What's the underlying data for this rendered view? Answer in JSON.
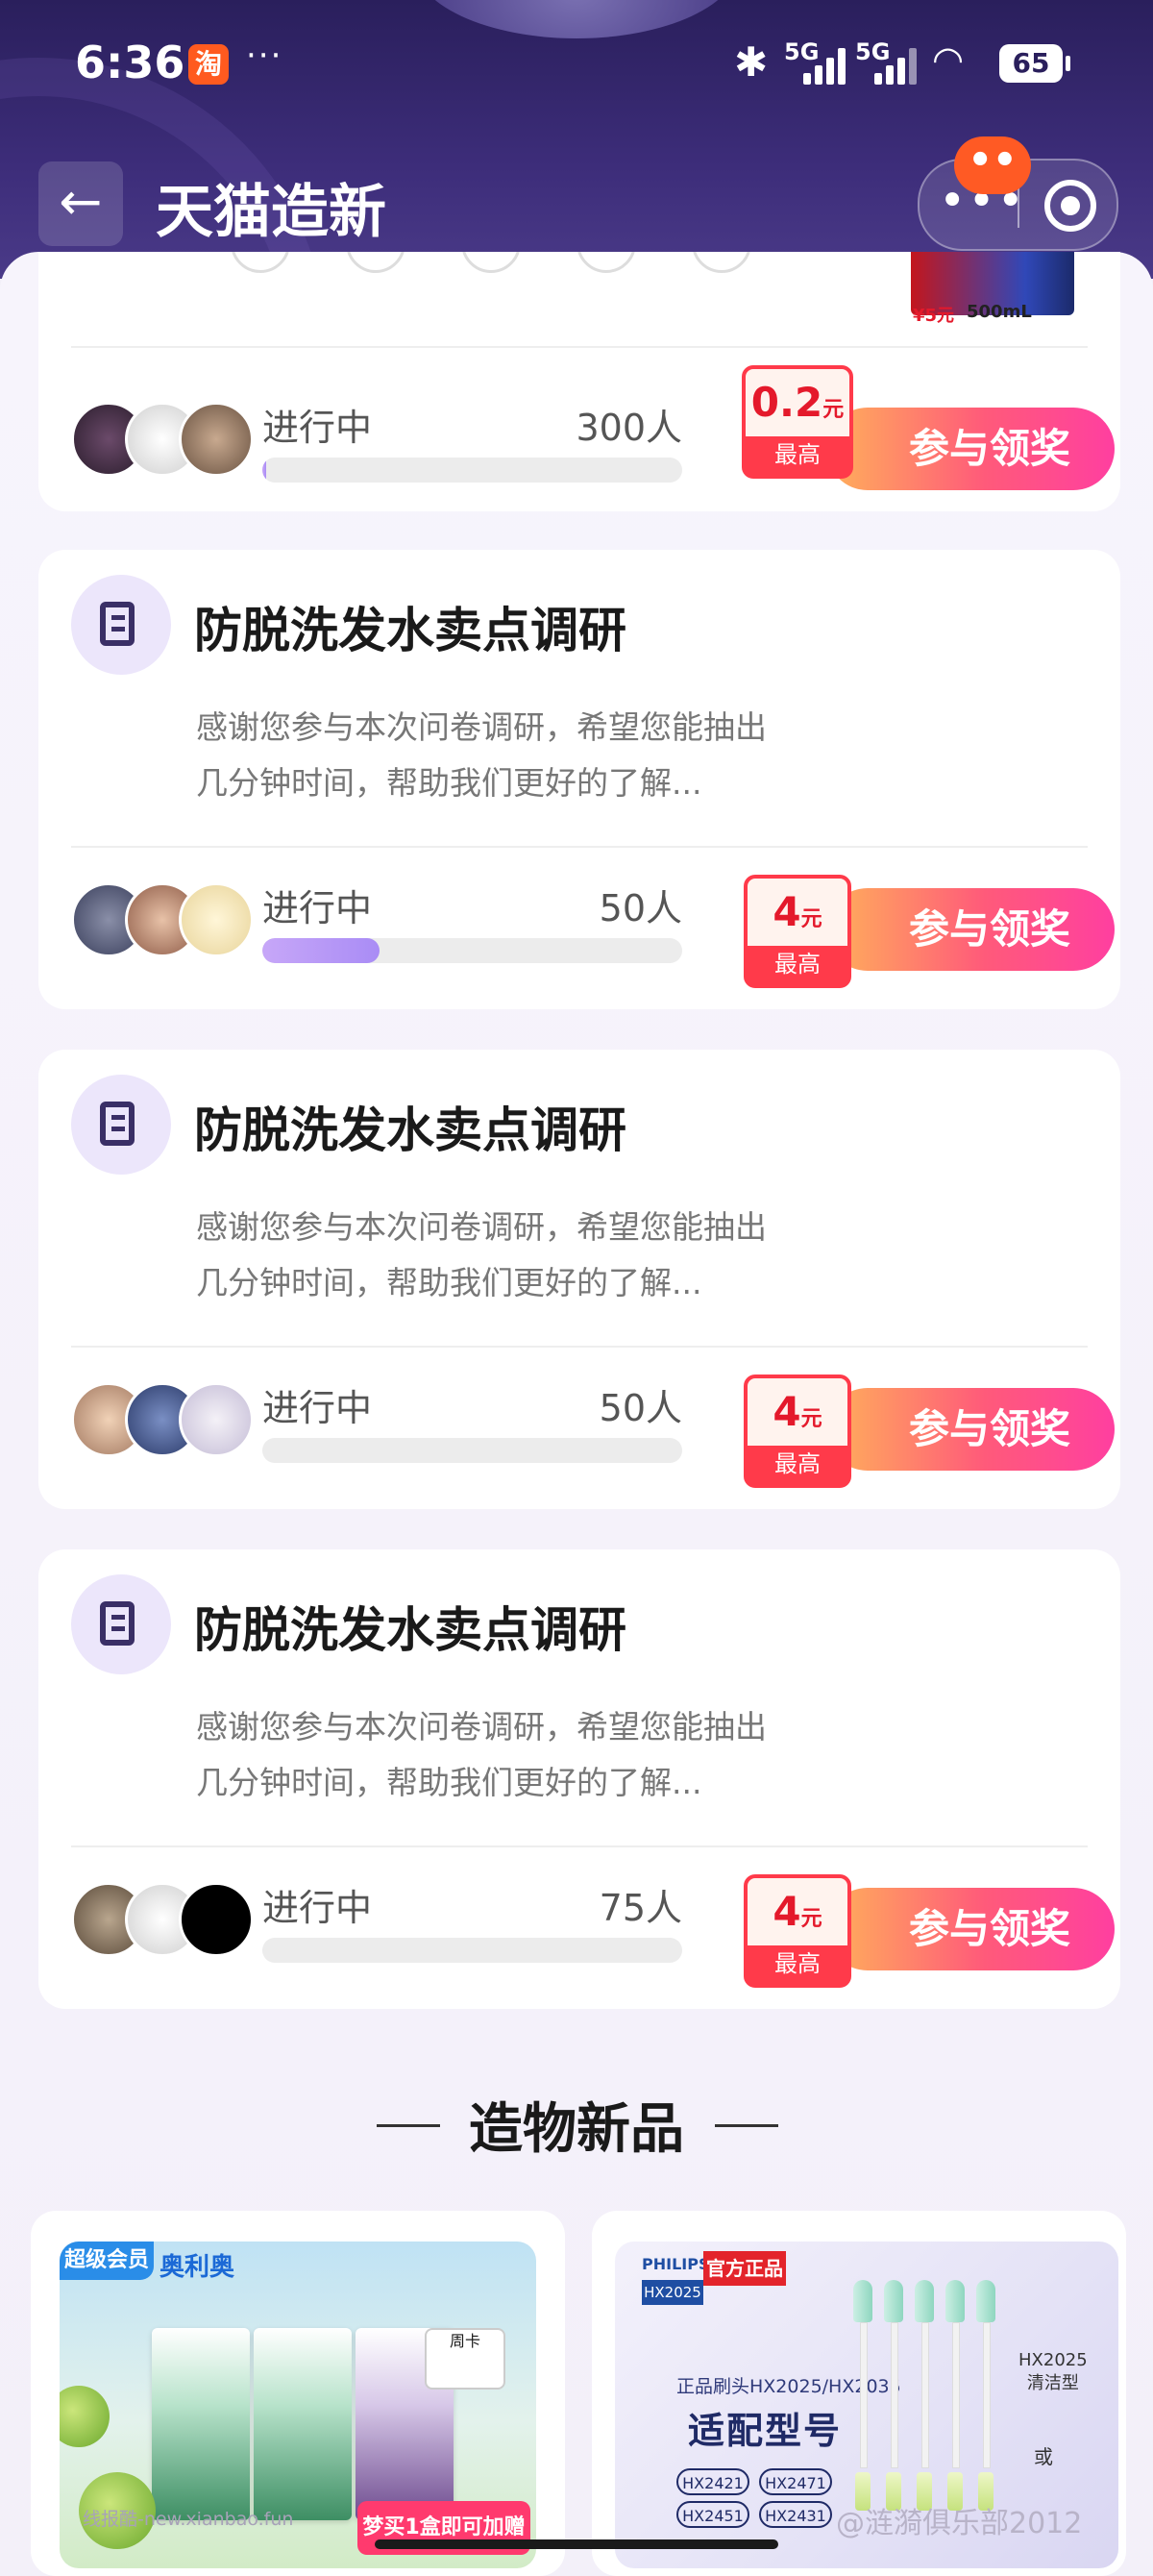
{
  "status_bar": {
    "time": "6:36",
    "app_badge": "淘",
    "more": "···",
    "network1": "5G",
    "network2": "5G",
    "battery": "65"
  },
  "nav": {
    "title": "天猫造新"
  },
  "first_card": {
    "status": "进行中",
    "count": "300人",
    "progress": 0.01,
    "prize_amount": "0.2",
    "prize_unit": "元",
    "prize_label": "最高",
    "button": "参与领奖",
    "product_price": "¥5元",
    "product_volume": "500mL"
  },
  "surveys": [
    {
      "title": "防脱洗发水卖点调研",
      "desc": "感谢您参与本次问卷调研，希望您能抽出几分钟时间，帮助我们更好的了解...",
      "status": "进行中",
      "count": "50人",
      "progress": 0.28,
      "prize_amount": "4",
      "prize_unit": "元",
      "prize_label": "最高",
      "button": "参与领奖"
    },
    {
      "title": "防脱洗发水卖点调研",
      "desc": "感谢您参与本次问卷调研，希望您能抽出几分钟时间，帮助我们更好的了解...",
      "status": "进行中",
      "count": "50人",
      "progress": 0,
      "prize_amount": "4",
      "prize_unit": "元",
      "prize_label": "最高",
      "button": "参与领奖"
    },
    {
      "title": "防脱洗发水卖点调研",
      "desc": "感谢您参与本次问卷调研，希望您能抽出几分钟时间，帮助我们更好的了解...",
      "status": "进行中",
      "count": "75人",
      "progress": 0,
      "prize_amount": "4",
      "prize_unit": "元",
      "prize_label": "最高",
      "button": "参与领奖"
    }
  ],
  "section": {
    "title": "造物新品"
  },
  "products": {
    "left": {
      "brand": "超级会员",
      "brand2": "奥利奥",
      "badge": "周卡",
      "promo": "梦买1盒即可加赠"
    },
    "right": {
      "brand": "PHILIPS",
      "model_box": "HX2025",
      "official": "官方正品",
      "subtitle": "正品刷头HX2025/HX2035",
      "title": "适配型号",
      "models": [
        "HX2421",
        "HX2471",
        "HX2451",
        "HX2431"
      ],
      "side_model": "HX2025",
      "side_type": "清洁型",
      "or": "或"
    }
  },
  "watermarks": {
    "left": "线报酷-new.xianbao.fun",
    "right": "@涟漪俱乐部2012"
  }
}
